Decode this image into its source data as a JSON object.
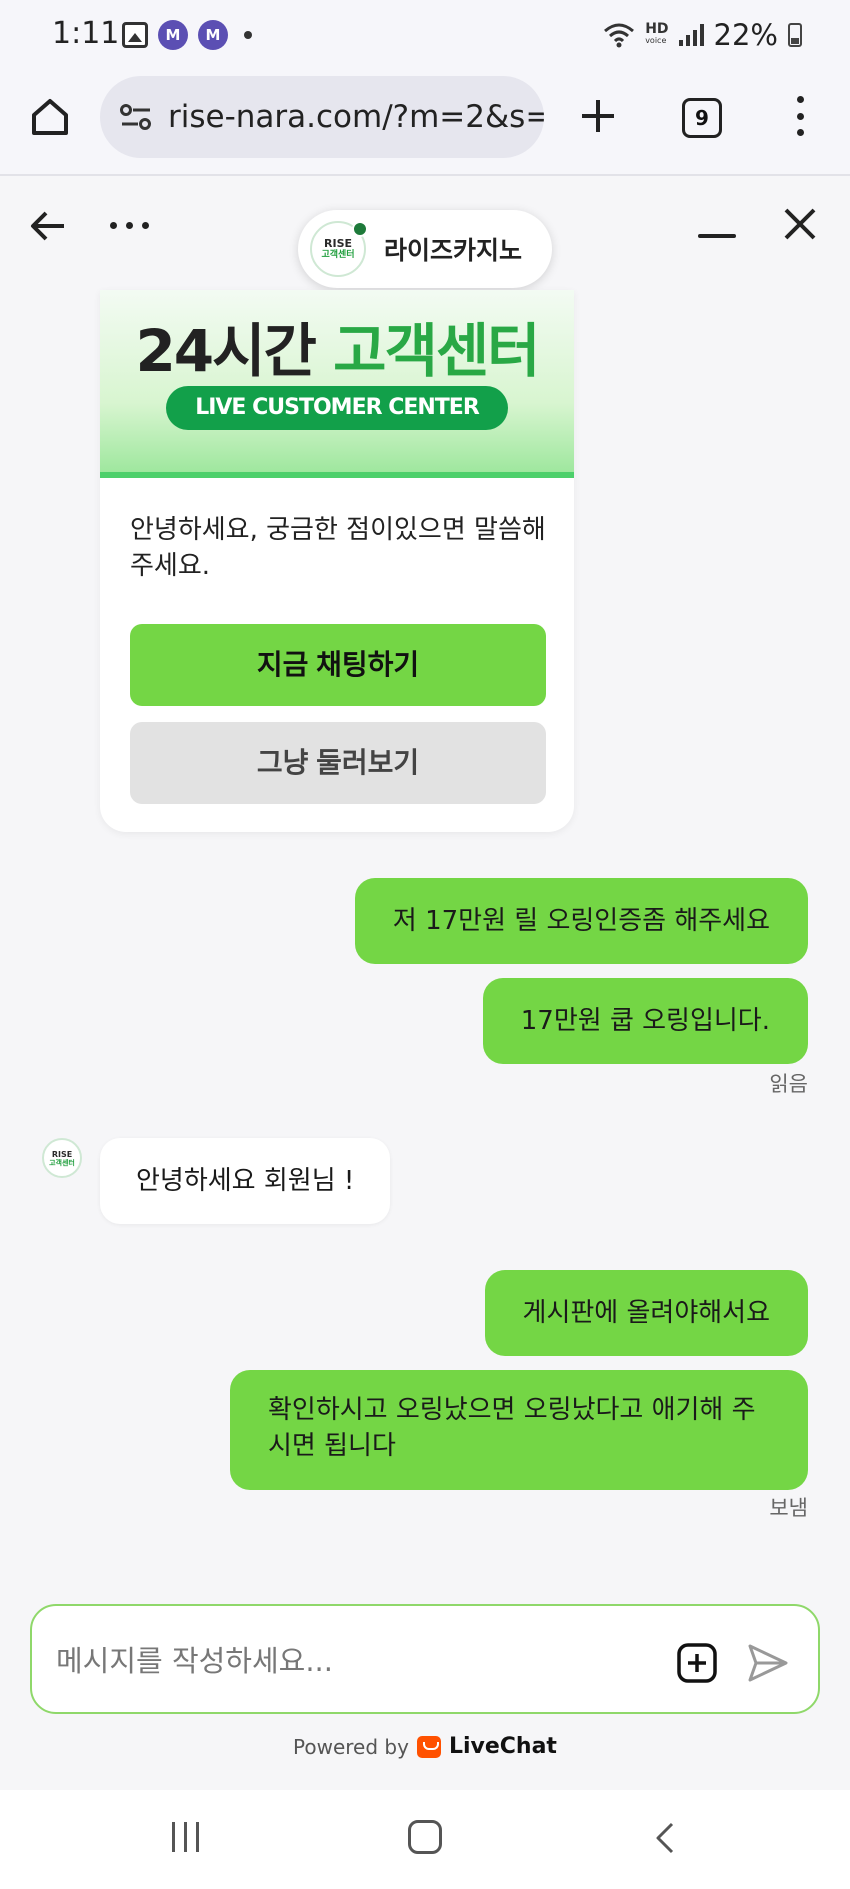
{
  "status_bar": {
    "time": "1:11",
    "notif_m1": "M",
    "notif_m2": "M",
    "hd": "HD",
    "hd_sub": "voice",
    "battery": "22%"
  },
  "browser": {
    "url": "rise-nara.com/?m=2&s=",
    "tab_count": "9"
  },
  "chat_header": {
    "brand_name": "라이즈카지노",
    "logo_line1": "RISE",
    "logo_line2": "고객센터"
  },
  "welcome": {
    "banner_title_dark": "24시간 ",
    "banner_title_green": "고객센터",
    "banner_subtitle": "LIVE CUSTOMER CENTER",
    "text": "안녕하세요, 궁금한 점이있으면 말씀해주세요.",
    "chat_now_label": "지금 채팅하기",
    "browse_label": "그냥 둘러보기"
  },
  "messages": [
    {
      "from": "user",
      "text": "저 17만원 릴 오링인증좀 해주세요"
    },
    {
      "from": "user",
      "text": "17만원 쿱 오링입니다."
    },
    {
      "status": "읽음"
    },
    {
      "from": "agent",
      "text": "안녕하세요 회원님 !"
    },
    {
      "from": "user",
      "text": "게시판에 올려야해서요"
    },
    {
      "from": "user",
      "text": "확인하시고 오링났으면 오링났다고 애기해 주시면 됩니다"
    },
    {
      "status": "보냄"
    }
  ],
  "composer": {
    "placeholder": "메시지를 작성하세요..."
  },
  "footer": {
    "powered_by": "Powered by",
    "brand": "LiveChat"
  },
  "colors": {
    "accent_green": "#74d645",
    "brand_green": "#29a845",
    "livechat_orange": "#ff5100"
  }
}
